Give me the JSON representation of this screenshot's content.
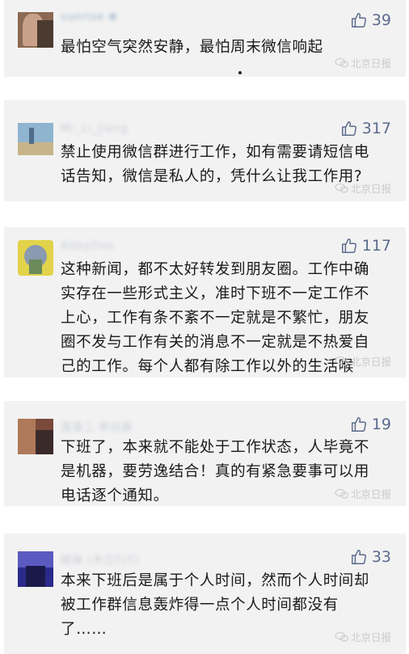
{
  "comments": [
    {
      "username": "sunrise ❀",
      "likes": "39",
      "text": "最怕空气突然安静，最怕周末微信响起",
      "watermark": "北京日报",
      "avatar_colors": [
        "#8a6a52",
        "#c9a18a",
        "#4a3a30"
      ]
    },
    {
      "username": "Mr_Li_Jiang",
      "likes": "317",
      "text": "禁止使用微信群进行工作，如有需要请短信电话告知，微信是私人的，凭什么让我工作用?",
      "watermark": "北京日报",
      "avatar_colors": [
        "#8fb4cf",
        "#c7b48a",
        "#4e6d8a"
      ]
    },
    {
      "username": "AbbyOoo",
      "likes": "117",
      "text": "这种新闻，都不太好转发到朋友圈。工作中确实存在一些形式主义，准时下班不一定工作不上心，工作有条不紊不一定就是不繁忙，朋友圈不发与工作有关的消息不一定就是不热爱自己的工作。每个人都有除工作以外的生活喉",
      "watermark": "北京日报",
      "avatar_colors": [
        "#e2d34a",
        "#8a9ab0",
        "#6a8a5a"
      ]
    },
    {
      "username": "落落二 李白路",
      "likes": "19",
      "text": "下班了，本来就不能处于工作状态，人毕竟不是机器，要劳逸结合！真的有紧急要事可以用电话逐个通知。",
      "watermark": "北京日报",
      "avatar_colors": [
        "#7a4a3a",
        "#b07a5a",
        "#3a2a2a"
      ]
    },
    {
      "username": "随缘 (木兰FLY)",
      "likes": "33",
      "text": "本来下班后是属于个人时间，然而个人时间却被工作群信息轰炸得一点个人时间都没有了……",
      "watermark": "北京日报",
      "avatar_colors": [
        "#2a2a8a",
        "#5a5ac0",
        "#1a1a4a"
      ]
    }
  ]
}
